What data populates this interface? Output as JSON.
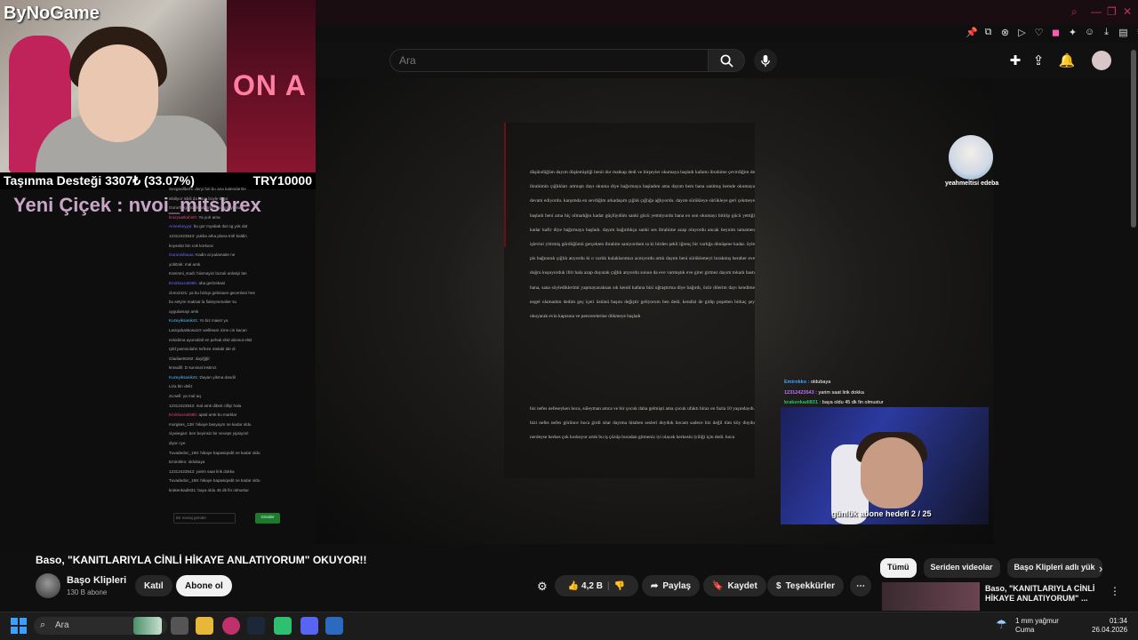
{
  "search": {
    "placeholder": "Ara"
  },
  "stream": {
    "brand": "ByNoGame",
    "poster_text": "ON A",
    "donation_label": "Taşınma Desteği 3307₺ (33.07%)",
    "donation_goal": "TRY10000",
    "donation_progress_percent": 33.07,
    "new_follower": "Yeni Çiçek : nvoi_mitsbrex",
    "sub_goal": "günlük abone hedefi 2 / 25",
    "avatar_name": "yeahmeltisi edeba",
    "overlay_chat": [
      {
        "user": "Emirokko :",
        "msg": " oldubaya"
      },
      {
        "user": "12312423543 :",
        "msg": " yarim saat lirik dokka"
      },
      {
        "user": "krakenkadi831 :",
        "msg": " baya oldu 45 dk fin olmustur"
      }
    ]
  },
  "chat": {
    "lines": [
      {
        "user": "",
        "msg": "Sevgiwillbehi: deryi futi bu ana kalendarrile"
      },
      {
        "user": "",
        "msg": "isbiliyor isbili da hoca boyle kaşıt"
      },
      {
        "user": "",
        "msg": "Gorurtvlig: hocik bayarlim bu hocaya kari"
      },
      {
        "user": "krazyaatkahinh:",
        "msg": " Ya yuh ama"
      },
      {
        "user": "Anreebeyyyi:",
        "msg": " bu gor myabak dat og yok dat"
      },
      {
        "user": "",
        "msg": "12312423543: yukba arka plana troll baldin"
      },
      {
        "user": "",
        "msg": "koyselar bin cok korkunc"
      },
      {
        "user": "Gorurwifaaaa:",
        "msg": " Kadin ai pulamaite ne"
      },
      {
        "user": "",
        "msg": "yoli0nik: mal amk"
      },
      {
        "user": "",
        "msg": "Kamnmi_Kadi: hiivmayici buzuk anlatiyi lan"
      },
      {
        "user": "Emirbaxrak88b:",
        "msg": " aha gerizekasi"
      },
      {
        "user": "",
        "msg": "cloro2421: ya bu biziqo gelmiaon gecenlani hes"
      },
      {
        "user": "",
        "msg": "bu selyim maksat la fialeyeemalier su"
      },
      {
        "user": "",
        "msg": "uygulamayi amk"
      },
      {
        "user": "Kuzeyiksanik41:",
        "msg": " Yo biz maiez ya"
      },
      {
        "user": "",
        "msg": "Laviqubaskosa10: wellteam icine cin kacan"
      },
      {
        "user": "",
        "msg": "evlodima ayumdinil en pehak elsit abonut elsit"
      },
      {
        "user": "",
        "msg": "rpfd jasmicdahn tvrfeze otelabi ide di"
      },
      {
        "user": "",
        "msg": "Gladiaet6282: dayiğğil"
      },
      {
        "user": "",
        "msg": "kmaxilli: D survival instinct"
      },
      {
        "user": "Kuzeyiksanik41:",
        "msg": " Dayarı yikma dandil"
      },
      {
        "user": "",
        "msg": "Liza bin deliz"
      },
      {
        "user": "",
        "msg": "2Lowfi: ya mal aq"
      },
      {
        "user": "",
        "msg": "12312423543: mal amk dibeti cilliyi hala"
      },
      {
        "user": "Emirbaxrak88b:",
        "msg": " aptal amk bu marklar"
      },
      {
        "user": "",
        "msg": "morgkes_138: hikaye basyaym ne kadar oldu"
      },
      {
        "user": "",
        "msg": "clywiegan: ben beyinsiz bir veceps yipsiyonl"
      },
      {
        "user": "",
        "msg": "diyor cye"
      },
      {
        "user": "",
        "msg": "Tuvadedoc_199: hikaye bapasiqedit ne kadar oldu"
      },
      {
        "user": "",
        "msg": "Emirokko: oldubaya"
      },
      {
        "user": "",
        "msg": "12312423543: yarim saat lirik dokka"
      },
      {
        "user": "",
        "msg": "Tuvadedoc_199: hikaye bapasiqedit ne kadar oldu"
      },
      {
        "user": "",
        "msg": "krakenkadi831: baya oldu 45 dk fin olmustur"
      }
    ],
    "input_placeholder": "Bir mesaj gönder",
    "send_label": "Gönder"
  },
  "story": {
    "paragraph1": "düşündüğüm dayım düşlemiştiği benii dur matkap dedi ve birşeyler okumaya başladı kafamı ibrahime çevirdiğim de ibrahimin çığlıkları artmıştı dayı okuma diye bağırmaya başladım ama dayım hem bana sanlmış hemde okumaya devam ediyordu. karşımda en sevdiğim arkadaşım çığlık çığlığa ağlıyordu. dayım sürükleye sürükleye geri çekmeye başladı beni ama hiç olmadığın kadar güçlüydüm sanki gücü yetmiyordu bana en son okumayı bitirip gücü yettiği kadar kafir diye bağırmaya başladı. dayım bağırdıkça sanki ses ibrahime azap oluyordu ancak beynim tamamen işlevini yitirmiş gördüğümü gerçekten ibrahim saniyordum ta ki birden şekli iğrenç bir varlığa dönüşene kadar. öyle pis bağırarak çığlık atıyordu ki o varlık kulaklarımızı acıtıyordu artık dayım beni sürüklemeyi bırakmış beraber eve doğru koşuyorduk ifrit hala azap duyarak çığlık atıyordu sonun da eve varmıştık eve girer girmez dayım tokadı bastı bana, sana söylediklerimi yapmayacaksan sık kendi kafana bizi uğraştırma diye bağırdı, özür dilerim dayı kendime engel olamadım dedim geç içeri üstünü başını değiştir geliyorum ben dedi. kendisi de gidip poşetten birkaç şey okuyarak evin kapısına ve pencerelerine dökmeye başladı",
    "paragraph2": "biz nefes nefeseyken hoca, süleyman amca ve bir çocuk daha gelmişti ama çocuk ufaktı biraz en fazla 10 yaşındaydı. bizi nefes nefes görünce hoca girdi sitar dayıma hitaben sesleri duyduk hocam sadece biz değil tüm köy duydu nerdeyse herkes çok korkuyor artık bu iş çözüp buradan gitmeniz iyi olacak herkesin iyiliği için dedi. hoca"
  },
  "video": {
    "title": "Baso, \"KANITLARIYLA CİNLİ HİKAYE ANLATIYORUM\" OKUYOR!!",
    "channel_name": "Başo Klipleri",
    "channel_subs": "130 B abone",
    "join_label": "Katıl",
    "subscribe_label": "Abone ol",
    "like_count": "4,2 B",
    "share_label": "Paylaş",
    "save_label": "Kaydet",
    "thanks_label": "Teşekkürler"
  },
  "chips": [
    "Tümü",
    "Seriden videolar",
    "Başo Klipleri adlı yük"
  ],
  "recommendation": {
    "title": "Baso, \"KANITLARIYLA CİNLİ HİKAYE ANLATIYORUM\" ..."
  },
  "taskbar": {
    "search_label": "Ara",
    "weather_line1": "1 mm yağmur",
    "weather_line2": "Cuma",
    "time": "01:34",
    "date": "26.04.2026"
  },
  "colors": {
    "accent": "#c0306a",
    "subscribe_bg": "#f1f1f1",
    "chat_highlight": "#d64a7a"
  }
}
